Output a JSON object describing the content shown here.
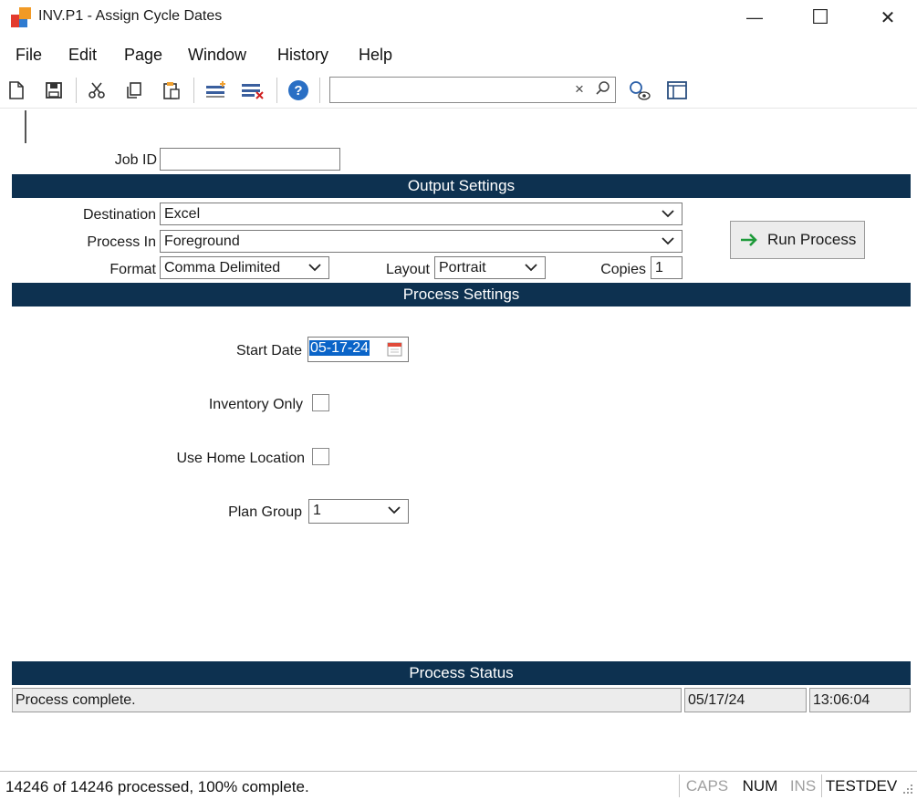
{
  "window": {
    "title": "INV.P1 - Assign Cycle Dates",
    "minimize_glyph": "—",
    "maximize_glyph": "☐",
    "close_glyph": "✕"
  },
  "menu": [
    "File",
    "Edit",
    "Page",
    "Window",
    "History",
    "Help"
  ],
  "toolbar": {
    "icons": [
      "new-document-icon",
      "save-icon",
      "cut-icon",
      "copy-icon",
      "paste-icon",
      "insert-row-icon",
      "delete-row-icon",
      "help-icon",
      "search-icon",
      "find-view-icon",
      "layout-icon"
    ],
    "search_value": "",
    "search_clear_glyph": "×"
  },
  "form": {
    "job_id_label": "Job ID",
    "job_id_value": "",
    "output_settings_title": "Output Settings",
    "destination_label": "Destination",
    "destination_value": "Excel",
    "process_in_label": "Process In",
    "process_in_value": "Foreground",
    "format_label": "Format",
    "format_value": "Comma Delimited",
    "layout_label": "Layout",
    "layout_value": "Portrait",
    "copies_label": "Copies",
    "copies_value": "1",
    "run_button_label": "Run Process",
    "process_settings_title": "Process Settings",
    "start_date_label": "Start Date",
    "start_date_value": "05-17-24",
    "inventory_only_label": "Inventory Only",
    "inventory_only_checked": false,
    "use_home_location_label": "Use Home Location",
    "use_home_location_checked": false,
    "plan_group_label": "Plan Group",
    "plan_group_value": "1"
  },
  "process_status": {
    "title": "Process Status",
    "message": "Process complete.",
    "date": "05/17/24",
    "time": "13:06:04"
  },
  "statusbar": {
    "message": "14246 of 14246 processed,  100% complete.",
    "caps": "CAPS",
    "num": "NUM",
    "ins": "INS",
    "env": "TESTDEV"
  },
  "colors": {
    "band": "#0d3150",
    "selection": "#0a64c8",
    "run_arrow": "#1e9a3a"
  }
}
